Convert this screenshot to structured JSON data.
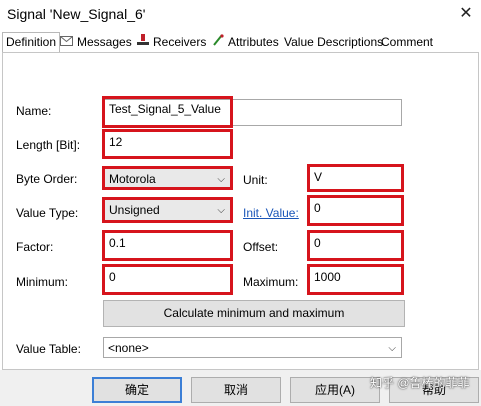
{
  "window": {
    "title": "Signal 'New_Signal_6'"
  },
  "tabs": [
    {
      "label": "Definition",
      "icon": "none"
    },
    {
      "label": "Messages",
      "icon": "envelope-icon"
    },
    {
      "label": "Receivers",
      "icon": "receiver-icon"
    },
    {
      "label": "Attributes",
      "icon": "attribute-icon"
    },
    {
      "label": "Value Descriptions",
      "icon": "none"
    },
    {
      "label": "Comment",
      "icon": "none"
    }
  ],
  "form": {
    "name_label": "Name:",
    "name_value": "Test_Signal_5_Value",
    "length_label": "Length [Bit]:",
    "length_value": "12",
    "byte_order_label": "Byte Order:",
    "byte_order_value": "Motorola",
    "unit_label": "Unit:",
    "unit_value": "V",
    "value_type_label": "Value Type:",
    "value_type_value": "Unsigned",
    "init_value_label": "Init. Value:",
    "init_value_value": "0",
    "factor_label": "Factor:",
    "factor_value": "0.1",
    "offset_label": "Offset:",
    "offset_value": "0",
    "minimum_label": "Minimum:",
    "minimum_value": "0",
    "maximum_label": "Maximum:",
    "maximum_value": "1000",
    "calc_button": "Calculate minimum and maximum",
    "value_table_label": "Value Table:",
    "value_table_value": "<none>"
  },
  "footer": {
    "ok": "确定",
    "cancel": "取消",
    "apply": "应用(A)",
    "help": "帮助"
  },
  "watermark": "知乎 @鲁棒的菲菲",
  "colors": {
    "highlight": "#d6141c",
    "link": "#1b56b8",
    "default_button_border": "#3c7fd6"
  }
}
